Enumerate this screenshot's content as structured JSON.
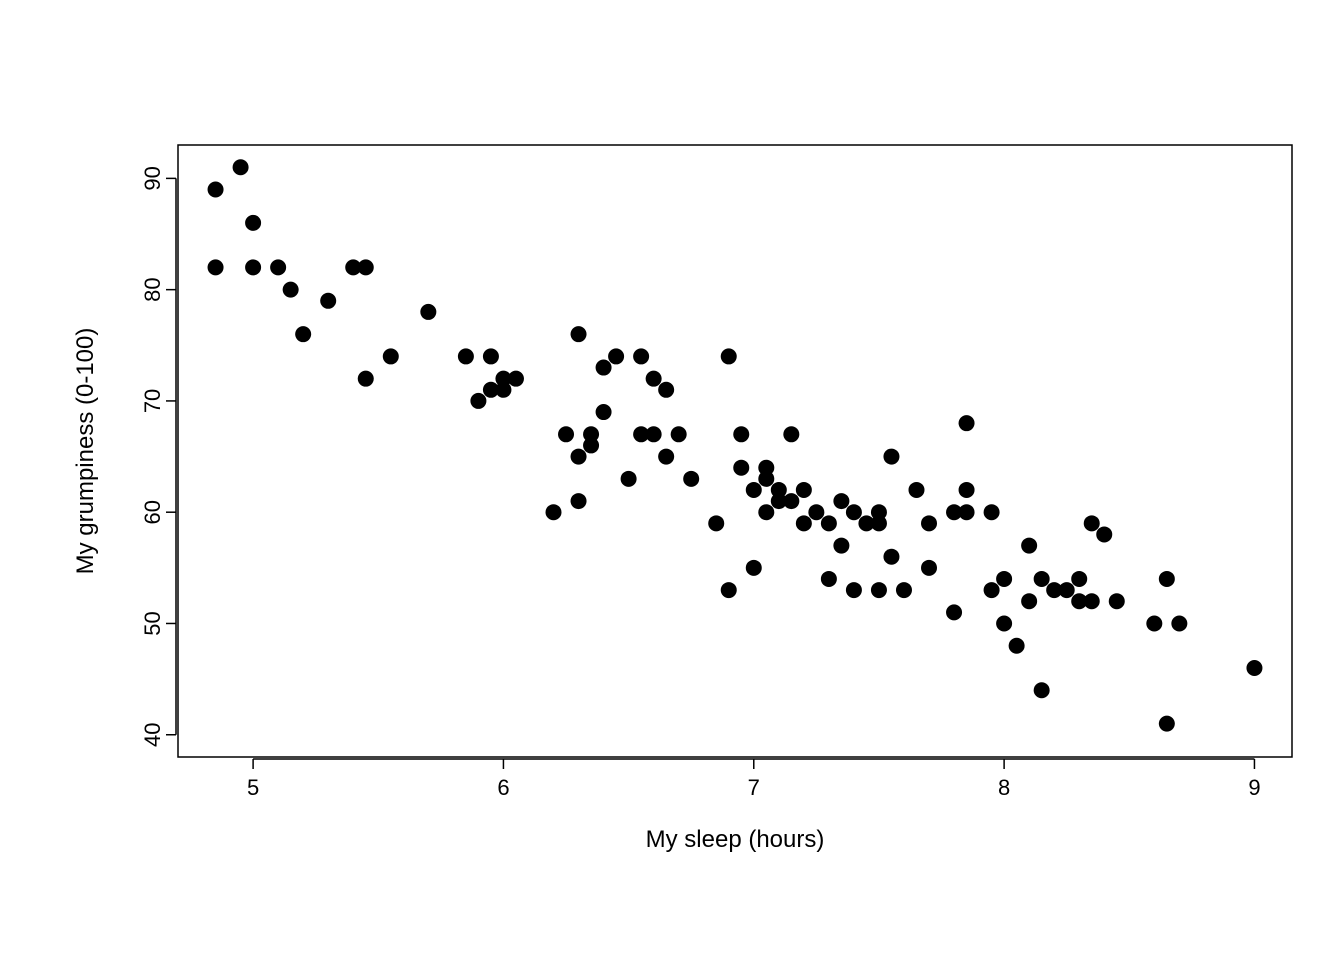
{
  "chart_data": {
    "type": "scatter",
    "xlabel": "My sleep (hours)",
    "ylabel": "My grumpiness (0-100)",
    "title": "",
    "xlim": [
      4.7,
      9.15
    ],
    "ylim": [
      38,
      93
    ],
    "x_ticks": [
      5,
      6,
      7,
      8,
      9
    ],
    "y_ticks": [
      40,
      50,
      60,
      70,
      80,
      90
    ],
    "points": [
      {
        "x": 4.85,
        "y": 89
      },
      {
        "x": 4.85,
        "y": 82
      },
      {
        "x": 4.95,
        "y": 91
      },
      {
        "x": 5.0,
        "y": 86
      },
      {
        "x": 5.0,
        "y": 82
      },
      {
        "x": 5.1,
        "y": 82
      },
      {
        "x": 5.15,
        "y": 80
      },
      {
        "x": 5.2,
        "y": 76
      },
      {
        "x": 5.3,
        "y": 79
      },
      {
        "x": 5.4,
        "y": 82
      },
      {
        "x": 5.45,
        "y": 82
      },
      {
        "x": 5.45,
        "y": 72
      },
      {
        "x": 5.55,
        "y": 74
      },
      {
        "x": 5.7,
        "y": 78
      },
      {
        "x": 5.85,
        "y": 74
      },
      {
        "x": 5.9,
        "y": 70
      },
      {
        "x": 5.95,
        "y": 71
      },
      {
        "x": 5.95,
        "y": 74
      },
      {
        "x": 6.0,
        "y": 72
      },
      {
        "x": 6.0,
        "y": 71
      },
      {
        "x": 6.05,
        "y": 72
      },
      {
        "x": 6.2,
        "y": 60
      },
      {
        "x": 6.25,
        "y": 67
      },
      {
        "x": 6.3,
        "y": 76
      },
      {
        "x": 6.3,
        "y": 65
      },
      {
        "x": 6.3,
        "y": 61
      },
      {
        "x": 6.35,
        "y": 67
      },
      {
        "x": 6.35,
        "y": 66
      },
      {
        "x": 6.4,
        "y": 73
      },
      {
        "x": 6.4,
        "y": 69
      },
      {
        "x": 6.45,
        "y": 74
      },
      {
        "x": 6.5,
        "y": 63
      },
      {
        "x": 6.55,
        "y": 67
      },
      {
        "x": 6.55,
        "y": 74
      },
      {
        "x": 6.6,
        "y": 72
      },
      {
        "x": 6.6,
        "y": 67
      },
      {
        "x": 6.65,
        "y": 65
      },
      {
        "x": 6.65,
        "y": 71
      },
      {
        "x": 6.7,
        "y": 67
      },
      {
        "x": 6.75,
        "y": 63
      },
      {
        "x": 6.85,
        "y": 59
      },
      {
        "x": 6.9,
        "y": 53
      },
      {
        "x": 6.9,
        "y": 74
      },
      {
        "x": 6.95,
        "y": 64
      },
      {
        "x": 6.95,
        "y": 67
      },
      {
        "x": 7.0,
        "y": 62
      },
      {
        "x": 7.0,
        "y": 55
      },
      {
        "x": 7.05,
        "y": 63
      },
      {
        "x": 7.05,
        "y": 60
      },
      {
        "x": 7.05,
        "y": 64
      },
      {
        "x": 7.1,
        "y": 61
      },
      {
        "x": 7.1,
        "y": 62
      },
      {
        "x": 7.15,
        "y": 67
      },
      {
        "x": 7.15,
        "y": 61
      },
      {
        "x": 7.2,
        "y": 59
      },
      {
        "x": 7.2,
        "y": 62
      },
      {
        "x": 7.25,
        "y": 60
      },
      {
        "x": 7.3,
        "y": 54
      },
      {
        "x": 7.3,
        "y": 59
      },
      {
        "x": 7.35,
        "y": 61
      },
      {
        "x": 7.35,
        "y": 57
      },
      {
        "x": 7.4,
        "y": 60
      },
      {
        "x": 7.4,
        "y": 53
      },
      {
        "x": 7.45,
        "y": 59
      },
      {
        "x": 7.5,
        "y": 60
      },
      {
        "x": 7.5,
        "y": 59
      },
      {
        "x": 7.5,
        "y": 53
      },
      {
        "x": 7.55,
        "y": 65
      },
      {
        "x": 7.55,
        "y": 56
      },
      {
        "x": 7.6,
        "y": 53
      },
      {
        "x": 7.65,
        "y": 62
      },
      {
        "x": 7.7,
        "y": 59
      },
      {
        "x": 7.7,
        "y": 55
      },
      {
        "x": 7.8,
        "y": 51
      },
      {
        "x": 7.8,
        "y": 60
      },
      {
        "x": 7.85,
        "y": 60
      },
      {
        "x": 7.85,
        "y": 62
      },
      {
        "x": 7.85,
        "y": 68
      },
      {
        "x": 7.95,
        "y": 53
      },
      {
        "x": 7.95,
        "y": 60
      },
      {
        "x": 8.0,
        "y": 54
      },
      {
        "x": 8.0,
        "y": 50
      },
      {
        "x": 8.05,
        "y": 48
      },
      {
        "x": 8.1,
        "y": 52
      },
      {
        "x": 8.1,
        "y": 57
      },
      {
        "x": 8.15,
        "y": 54
      },
      {
        "x": 8.15,
        "y": 44
      },
      {
        "x": 8.2,
        "y": 53
      },
      {
        "x": 8.25,
        "y": 53
      },
      {
        "x": 8.3,
        "y": 52
      },
      {
        "x": 8.3,
        "y": 54
      },
      {
        "x": 8.35,
        "y": 59
      },
      {
        "x": 8.35,
        "y": 52
      },
      {
        "x": 8.4,
        "y": 58
      },
      {
        "x": 8.45,
        "y": 52
      },
      {
        "x": 8.6,
        "y": 50
      },
      {
        "x": 8.65,
        "y": 41
      },
      {
        "x": 8.65,
        "y": 54
      },
      {
        "x": 8.7,
        "y": 50
      },
      {
        "x": 9.0,
        "y": 46
      }
    ]
  }
}
